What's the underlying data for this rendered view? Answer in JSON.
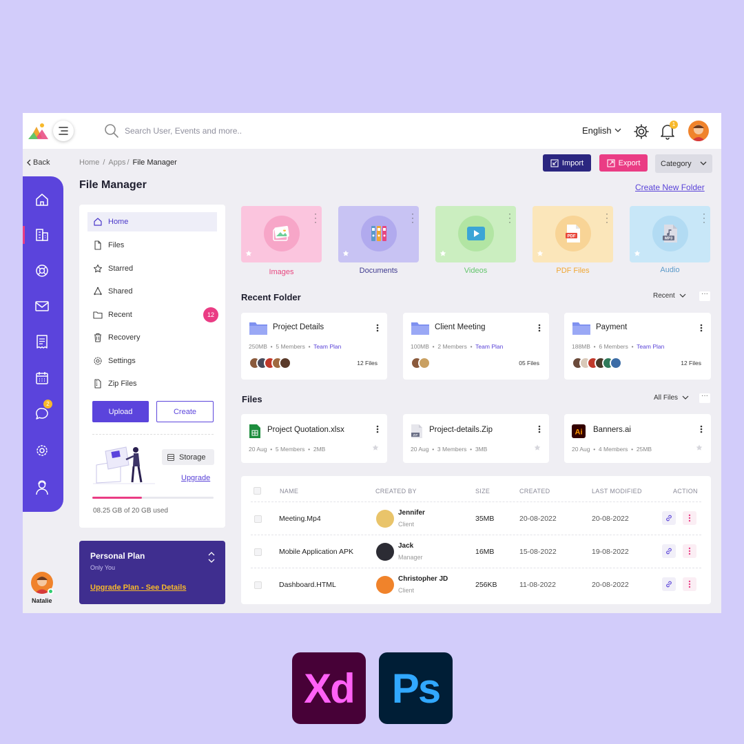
{
  "topbar": {
    "search_placeholder": "Search User, Events and more..",
    "language": "English",
    "notification_count": "1"
  },
  "nav": {
    "back": "Back",
    "breadcrumb": [
      "Home",
      "/",
      "Apps",
      "/",
      "File Manager"
    ],
    "page_title": "File Manager"
  },
  "actions": {
    "import": "Import",
    "export": "Export",
    "category": "Category",
    "create_folder": "Create New Folder"
  },
  "sidebar": {
    "chat_badge": "2",
    "user_name": "Natalie"
  },
  "menu": {
    "items": [
      {
        "label": "Home",
        "icon": "home-icon"
      },
      {
        "label": "Files",
        "icon": "file-icon"
      },
      {
        "label": "Starred",
        "icon": "star-icon"
      },
      {
        "label": "Shared",
        "icon": "share-icon"
      },
      {
        "label": "Recent",
        "icon": "folder-icon"
      },
      {
        "label": "Recovery",
        "icon": "trash-icon"
      },
      {
        "label": "Settings",
        "icon": "gear-icon"
      },
      {
        "label": "Zip Files",
        "icon": "zip-icon"
      }
    ],
    "recent_badge": "12",
    "upload": "Upload",
    "create": "Create"
  },
  "storage": {
    "label": "Storage",
    "upgrade": "Upgrade",
    "used_text": "08.25 GB of 20 GB used",
    "used_fraction": 0.41
  },
  "plan": {
    "title": "Personal Plan",
    "subtitle": "Only You",
    "link": "Upgrade Plan - See Details"
  },
  "categories": [
    {
      "label": "Images",
      "bg": "#fbc5de",
      "circle": "#f7a6c8",
      "color": "#e8467f"
    },
    {
      "label": "Documents",
      "bg": "#c8c3f3",
      "circle": "#b1aaee",
      "color": "#3f3a8f"
    },
    {
      "label": "Videos",
      "bg": "#cbeec0",
      "circle": "#b2e5a3",
      "color": "#62c56a"
    },
    {
      "label": "PDF Files",
      "bg": "#fbe6ba",
      "circle": "#f8d496",
      "color": "#f0a732"
    },
    {
      "label": "Audio",
      "bg": "#c8e7f8",
      "circle": "#b2dbf3",
      "color": "#5b9ac9"
    }
  ],
  "recent_folder": {
    "title": "Recent Folder",
    "filter": "Recent",
    "folders": [
      {
        "name": "Project Details",
        "size": "250MB",
        "members": "5 Members",
        "plan": "Team Plan",
        "files": "12 Files"
      },
      {
        "name": "Client Meeting",
        "size": "100MB",
        "members": "2 Members",
        "plan": "Team Plan",
        "files": "05 Files"
      },
      {
        "name": "Payment",
        "size": "188MB",
        "members": "6 Members",
        "plan": "Team Plan",
        "files": "12 Files"
      }
    ]
  },
  "files": {
    "title": "Files",
    "filter": "All Files",
    "items": [
      {
        "name": "Project Quotation.xlsx",
        "date": "20 Aug",
        "members": "5 Members",
        "size": "2MB"
      },
      {
        "name": "Project-details.Zip",
        "date": "20 Aug",
        "members": "3 Members",
        "size": "3MB"
      },
      {
        "name": "Banners.ai",
        "date": "20 Aug",
        "members": "4 Members",
        "size": "25MB"
      }
    ]
  },
  "table": {
    "headers": [
      "NAME",
      "CREATED BY",
      "SIZE",
      "CREATED",
      "LAST MODIFIED",
      "ACTION"
    ],
    "rows": [
      {
        "name": "Meeting.Mp4",
        "person": "Jennifer",
        "role": "Client",
        "size": "35MB",
        "created": "20-08-2022",
        "modified": "20-08-2022"
      },
      {
        "name": "Mobile Application APK",
        "person": "Jack",
        "role": "Manager",
        "size": "16MB",
        "created": "15-08-2022",
        "modified": "19-08-2022"
      },
      {
        "name": "Dashboard.HTML",
        "person": "Christopher JD",
        "role": "Client",
        "size": "256KB",
        "created": "11-08-2022",
        "modified": "20-08-2022"
      }
    ]
  },
  "badges": {
    "xd": "Xd",
    "ps": "Ps"
  }
}
